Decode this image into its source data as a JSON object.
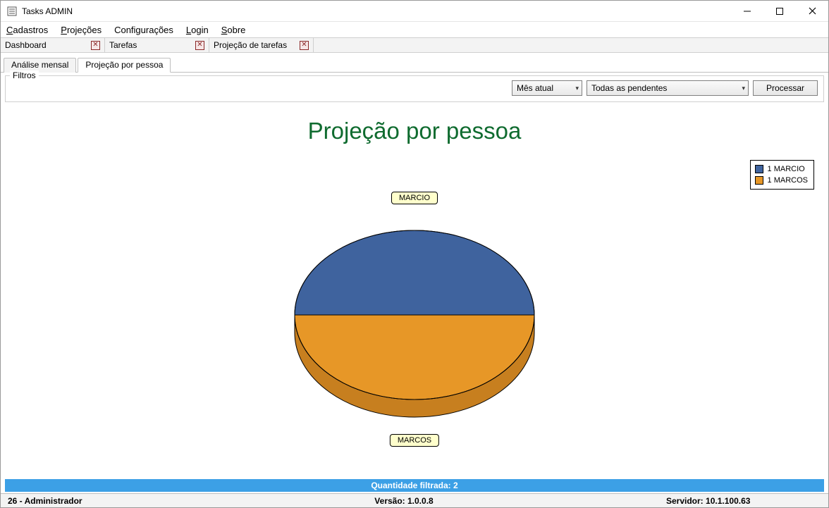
{
  "window": {
    "title": "Tasks ADMIN"
  },
  "menubar": {
    "items": [
      {
        "label": "Cadastros",
        "u": "C"
      },
      {
        "label": "Projeções",
        "u": "P"
      },
      {
        "label": "Configurações",
        "u": ""
      },
      {
        "label": "Login",
        "u": "L"
      },
      {
        "label": "Sobre",
        "u": "S"
      }
    ]
  },
  "doc_tabs": [
    {
      "label": "Dashboard"
    },
    {
      "label": "Tarefas"
    },
    {
      "label": "Projeção de tarefas"
    }
  ],
  "sub_tabs": [
    {
      "label": "Análise mensal",
      "active": false
    },
    {
      "label": "Projeção por pessoa",
      "active": true
    }
  ],
  "filters": {
    "legend": "Filtros",
    "period": "Mês atual",
    "status": "Todas as pendentes",
    "process_label": "Processar"
  },
  "chart_data": {
    "type": "pie",
    "title": "Projeção por pessoa",
    "series": [
      {
        "name": "MARCIO",
        "value": 1,
        "color": "#3f639e"
      },
      {
        "name": "MARCOS",
        "value": 1,
        "color": "#e79727"
      }
    ],
    "legend": [
      {
        "label": "1 MARCIO",
        "color": "#3f639e"
      },
      {
        "label": "1 MARCOS",
        "color": "#e79727"
      }
    ]
  },
  "summary": {
    "text": "Quantidade filtrada: 2"
  },
  "status": {
    "user": "26 - Administrador",
    "version_label": "Versão:",
    "version": "1.0.0.8",
    "server_label": "Servidor:",
    "server": "10.1.100.63"
  }
}
